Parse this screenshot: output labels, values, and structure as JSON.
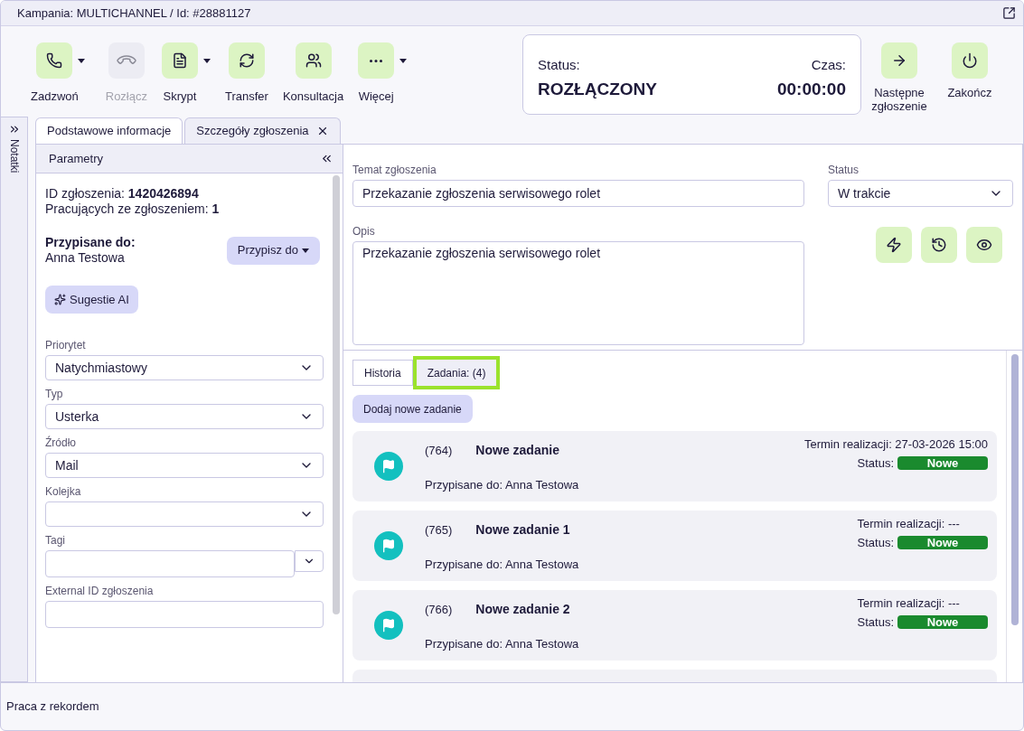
{
  "window": {
    "title": "Kampania: MULTICHANNEL / Id: #28881127"
  },
  "toolbar": [
    {
      "kind": "call",
      "label": "Zadzwoń",
      "disabled": false,
      "dropdown": true
    },
    {
      "kind": "hangup",
      "label": "Rozłącz",
      "disabled": true,
      "dropdown": false
    },
    {
      "kind": "script",
      "label": "Skrypt",
      "disabled": false,
      "dropdown": true
    },
    {
      "kind": "transfer",
      "label": "Transfer",
      "disabled": false,
      "dropdown": false
    },
    {
      "kind": "consult",
      "label": "Konsultacja",
      "disabled": false,
      "dropdown": false
    },
    {
      "kind": "more",
      "label": "Więcej",
      "disabled": false,
      "dropdown": true
    }
  ],
  "status_card": {
    "status_label": "Status:",
    "status": "ROZŁĄCZONY",
    "time_label": "Czas:",
    "time": "00:00:00"
  },
  "right_actions": [
    {
      "kind": "next",
      "label": "Następne zgłoszenie"
    },
    {
      "kind": "end",
      "label": "Zakończ"
    }
  ],
  "notes_tab": {
    "label": "Notatki"
  },
  "tabs": [
    {
      "label": "Podstawowe informacje",
      "selected": true,
      "closable": false
    },
    {
      "label": "Szczegóły zgłoszenia",
      "selected": false,
      "closable": true
    }
  ],
  "params": {
    "title": "Parametry",
    "id_line": "ID zgłoszenia: **1420426894**",
    "workers_line": "Pracujących ze zgłoszeniem: **1**",
    "assigned_label": "Przypisane do:",
    "assigned_name": "Anna Testowa",
    "assign_button": "Przypisz do",
    "ai_button": "Sugestie AI",
    "fields": [
      {
        "kind": "select",
        "label": "Priorytet",
        "value": "Natychmiastowy"
      },
      {
        "kind": "select",
        "label": "Typ",
        "value": "Usterka"
      },
      {
        "kind": "select",
        "label": "Źródło",
        "value": "Mail"
      },
      {
        "kind": "select",
        "label": "Kolejka"
      },
      {
        "kind": "tags",
        "label": "Tagi"
      },
      {
        "kind": "text",
        "label": "External ID zgłoszenia"
      }
    ]
  },
  "details": {
    "subject_label": "Temat zgłoszenia",
    "subject": "Przekazanie zgłoszenia serwisowego rolet",
    "status_label": "Status",
    "status": "W trakcie",
    "description_label": "Opis",
    "description": "Przekazanie zgłoszenia serwisowego rolet"
  },
  "action_icons": [
    {
      "kind": "flash"
    },
    {
      "kind": "history"
    },
    {
      "kind": "view"
    }
  ],
  "sub_tabs": [
    {
      "label": "Historia",
      "selected": false
    },
    {
      "label": "Zadania: (4)",
      "selected": true
    }
  ],
  "add_task_button": "Dodaj nowe zadanie",
  "tasks": [
    {
      "number": "(764)",
      "title": "Nowe zadanie",
      "due": "Termin realizacji: 27-03-2026 15:00",
      "status_label": "Status:",
      "status": "Nowe",
      "color": "#1a8a2e",
      "assigned": "Przypisane do: Anna Testowa"
    },
    {
      "number": "(765)",
      "title": "Nowe zadanie 1",
      "due": "Termin realizacji: ---",
      "status_label": "Status:",
      "status": "Nowe",
      "color": "#1a8a2e",
      "assigned": "Przypisane do: Anna Testowa"
    },
    {
      "number": "(766)",
      "title": "Nowe zadanie 2",
      "due": "Termin realizacji: ---",
      "status_label": "Status:",
      "status": "Nowe",
      "color": "#1a8a2e",
      "assigned": "Przypisane do: Anna Testowa"
    }
  ],
  "tasks_cut_below": true,
  "footer": {
    "label": "Praca z rekordem"
  }
}
